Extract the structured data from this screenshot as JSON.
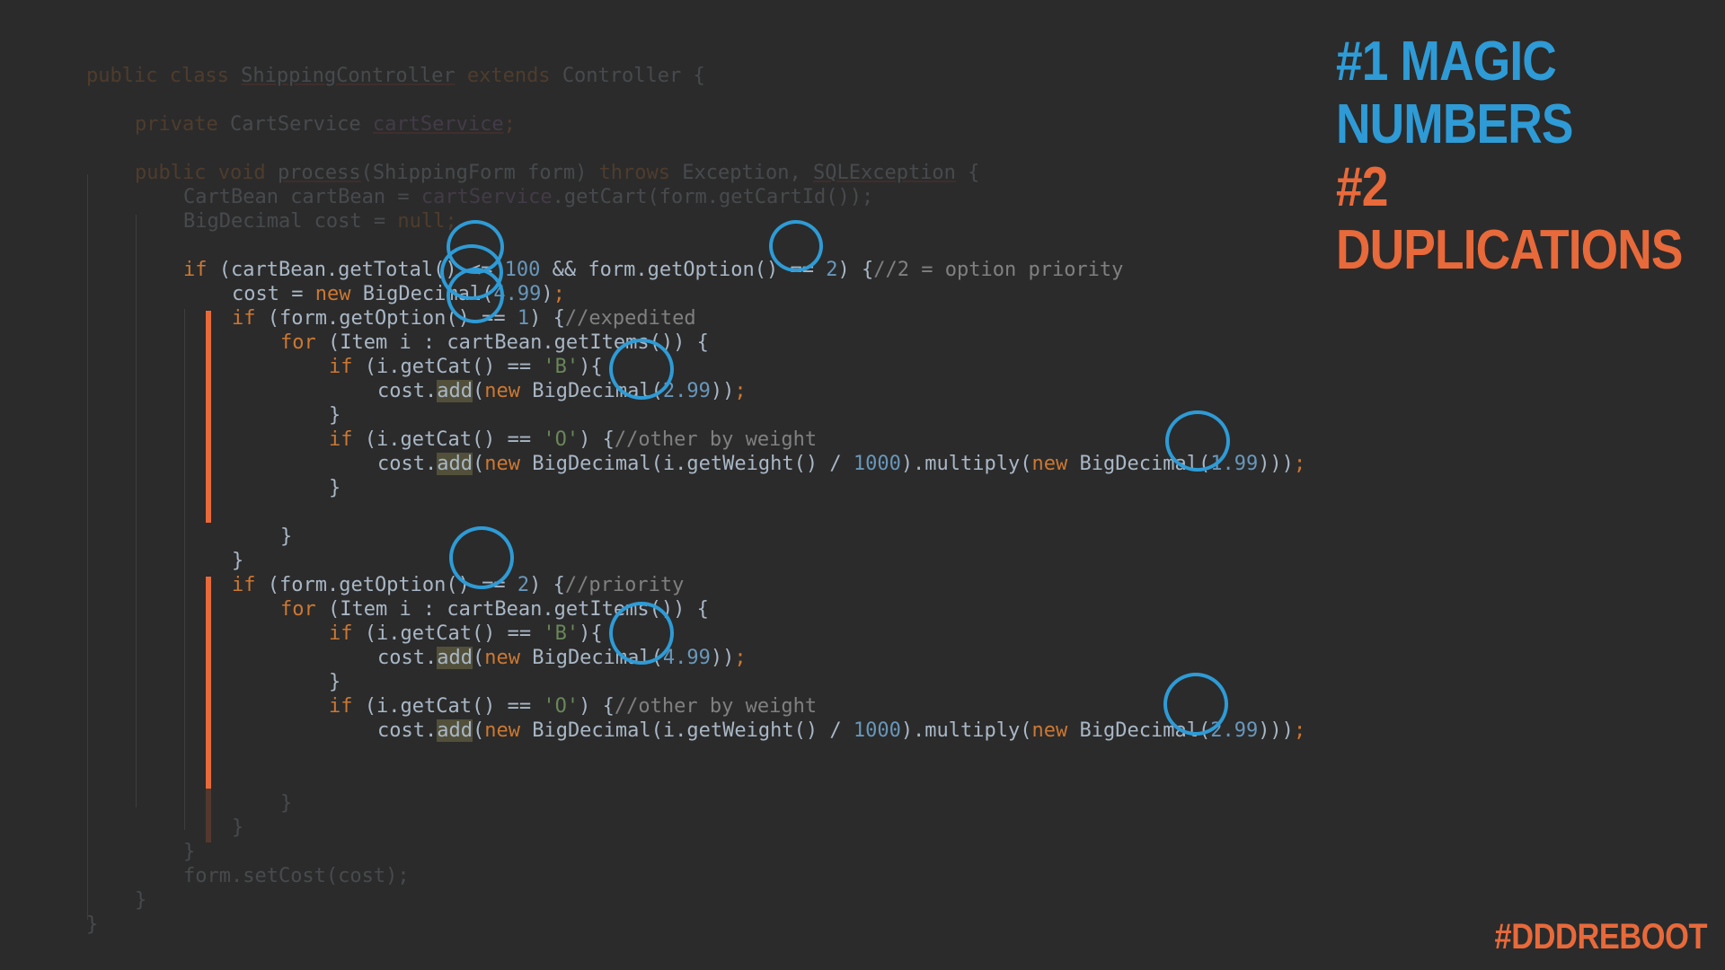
{
  "slide": {
    "title_line1": "#1 MAGIC",
    "title_line2": "NUMBERS",
    "title_line3": "#2 DUPLICATIONS",
    "hashtag": "#DDDREBOOT"
  },
  "colors": {
    "keyword": "#cc7832",
    "identifier": "#a9b7c6",
    "number": "#6897bb",
    "string": "#6a8759",
    "comment": "#808080",
    "highlight_circle": "#2e9bd6",
    "accent_orange": "#e8693a",
    "background": "#2b2b2b"
  },
  "code": {
    "l1": {
      "a": "public class ",
      "b": "ShippingController",
      "c": " extends ",
      "d": "Controller {"
    },
    "l3": {
      "a": "private ",
      "b": "CartService ",
      "c": "cartService",
      "d": ";"
    },
    "l5": {
      "a": "public void ",
      "b": "process",
      "c": "(ShippingForm form) ",
      "d": "throws ",
      "e": "Exception, ",
      "f": "SQLException",
      "g": " {"
    },
    "l6": {
      "a": "CartBean cartBean = ",
      "b": "cartService",
      "c": ".getCart(form.getCartId());"
    },
    "l7": {
      "a": "BigDecimal cost = ",
      "b": "null",
      "c": ";"
    },
    "l9": {
      "a": "if ",
      "b": "(cartBean.getTotal() <= ",
      "c": "100",
      "d": " && form.getOption() == ",
      "e": "2",
      "f": ") {",
      "g": "//2 = option priority"
    },
    "l10": {
      "a": "cost = ",
      "b": "new ",
      "c": "BigDecimal(",
      "d": "4.99",
      "e": ")",
      "f": ";"
    },
    "l11": {
      "a": "if ",
      "b": "(form.getOption() == ",
      "c": "1",
      "d": ") {",
      "e": "//expedited"
    },
    "l12": {
      "a": "for ",
      "b": "(Item i : cartBean.getItems()) {"
    },
    "l13": {
      "a": "if ",
      "b": "(i.getCat() == ",
      "c": "'B'",
      "d": "){"
    },
    "l14": {
      "a": "cost.",
      "b": "add",
      "c": "(",
      "d": "new ",
      "e": "BigDecimal(",
      "f": "2.99",
      "g": "))",
      "h": ";"
    },
    "l15": {
      "a": "}"
    },
    "l16": {
      "a": "if ",
      "b": "(i.getCat() == ",
      "c": "'O'",
      "d": ") {",
      "e": "//other by weight"
    },
    "l17": {
      "a": "cost.",
      "b": "add",
      "c": "(",
      "d": "new ",
      "e": "BigDecimal(i.getWeight() / ",
      "f": "1000",
      "g": ").multiply(",
      "h": "new ",
      "i": "BigDecimal(",
      "j": "1.99",
      "k": ")))",
      "l": ";"
    },
    "l18": {
      "a": "}"
    },
    "l20": {
      "a": "}"
    },
    "l21": {
      "a": "}"
    },
    "l22": {
      "a": "if ",
      "b": "(form.getOption() == ",
      "c": "2",
      "d": ") {",
      "e": "//priority"
    },
    "l23": {
      "a": "for ",
      "b": "(Item i : cartBean.getItems()) {"
    },
    "l24": {
      "a": "if ",
      "b": "(i.getCat() == ",
      "c": "'B'",
      "d": "){"
    },
    "l25": {
      "a": "cost.",
      "b": "add",
      "c": "(",
      "d": "new ",
      "e": "BigDecimal(",
      "f": "4.99",
      "g": "))",
      "h": ";"
    },
    "l26": {
      "a": "}"
    },
    "l27": {
      "a": "if ",
      "b": "(i.getCat() == ",
      "c": "'O'",
      "d": ") {",
      "e": "//other by weight"
    },
    "l28": {
      "a": "cost.",
      "b": "add",
      "c": "(",
      "d": "new ",
      "e": "BigDecimal(i.getWeight() / ",
      "f": "1000",
      "g": ").multiply(",
      "h": "new ",
      "i": "BigDecimal(",
      "j": "2.99",
      "k": ")))",
      "l": ";"
    },
    "l29": {
      "a": "}"
    },
    "l31": {
      "a": "}"
    },
    "l32": {
      "a": "}"
    },
    "l33": {
      "a": "}"
    },
    "l34": {
      "a": "form.setCost(cost);"
    },
    "l35": {
      "a": "}"
    },
    "l36": {
      "a": "}"
    }
  }
}
